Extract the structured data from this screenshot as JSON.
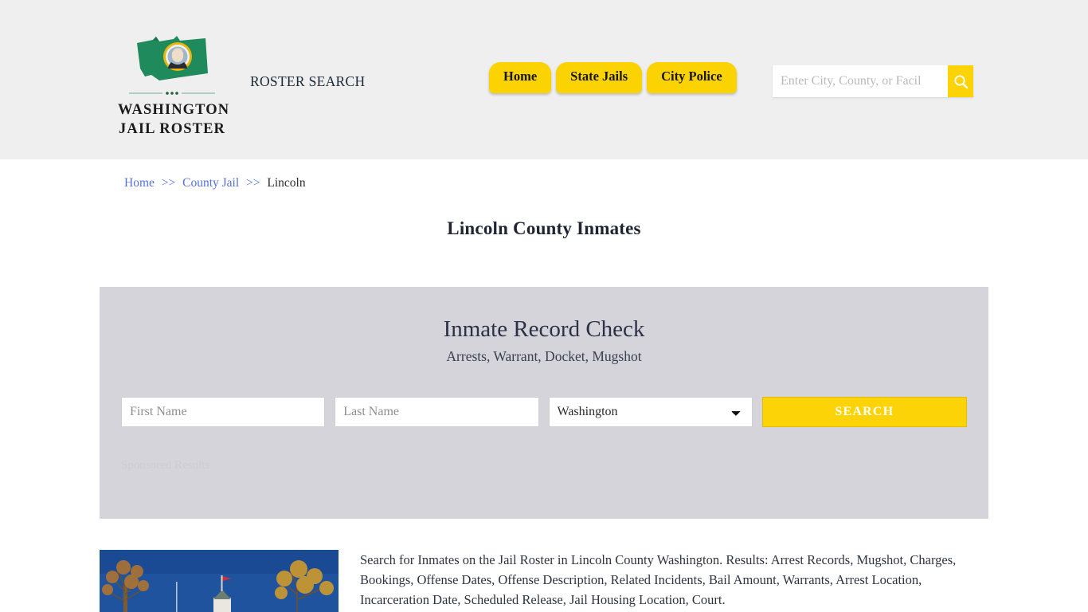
{
  "header": {
    "logo": {
      "icon": "washington-state-flag-icon",
      "line1": "WASHINGTON",
      "line2": "JAIL ROSTER"
    },
    "site_tagline": "ROSTER SEARCH",
    "nav": [
      {
        "label": "Home"
      },
      {
        "label": "State Jails"
      },
      {
        "label": "City Police"
      }
    ],
    "search": {
      "placeholder": "Enter City, County, or Facil",
      "value": "",
      "button_icon": "search-icon"
    },
    "background_color": "#efefef"
  },
  "breadcrumb": {
    "items": [
      {
        "label": "Home",
        "link": true
      },
      {
        "label": "County Jail",
        "link": true
      },
      {
        "label": "Lincoln",
        "link": false
      }
    ],
    "separator": ">>"
  },
  "page_title": "Lincoln County Inmates",
  "widget": {
    "title": "Inmate Record Check",
    "subtitle": "Arrests, Warrant, Docket, Mugshot",
    "first_name_placeholder": "First Name",
    "first_name_value": "",
    "last_name_placeholder": "Last Name",
    "last_name_value": "",
    "state_selected": "Washington",
    "state_options": [
      "Washington"
    ],
    "search_button": "SEARCH",
    "sponsored_label": "Sponsored Results",
    "panel_color": "#d4d4da",
    "accent_color": "#fcd307"
  },
  "content": {
    "photo_alt": "lincoln-county-courthouse-photo",
    "paragraph": "Search for Inmates on the Jail Roster in Lincoln County Washington. Results: Arrest Records, Mugshot, Charges, Bookings, Offense Dates, Offense Description, Related Incidents, Bail Amount, Warrants, Arrest Location, Incarceration Date, Scheduled Release, Jail Housing Location, Court."
  }
}
